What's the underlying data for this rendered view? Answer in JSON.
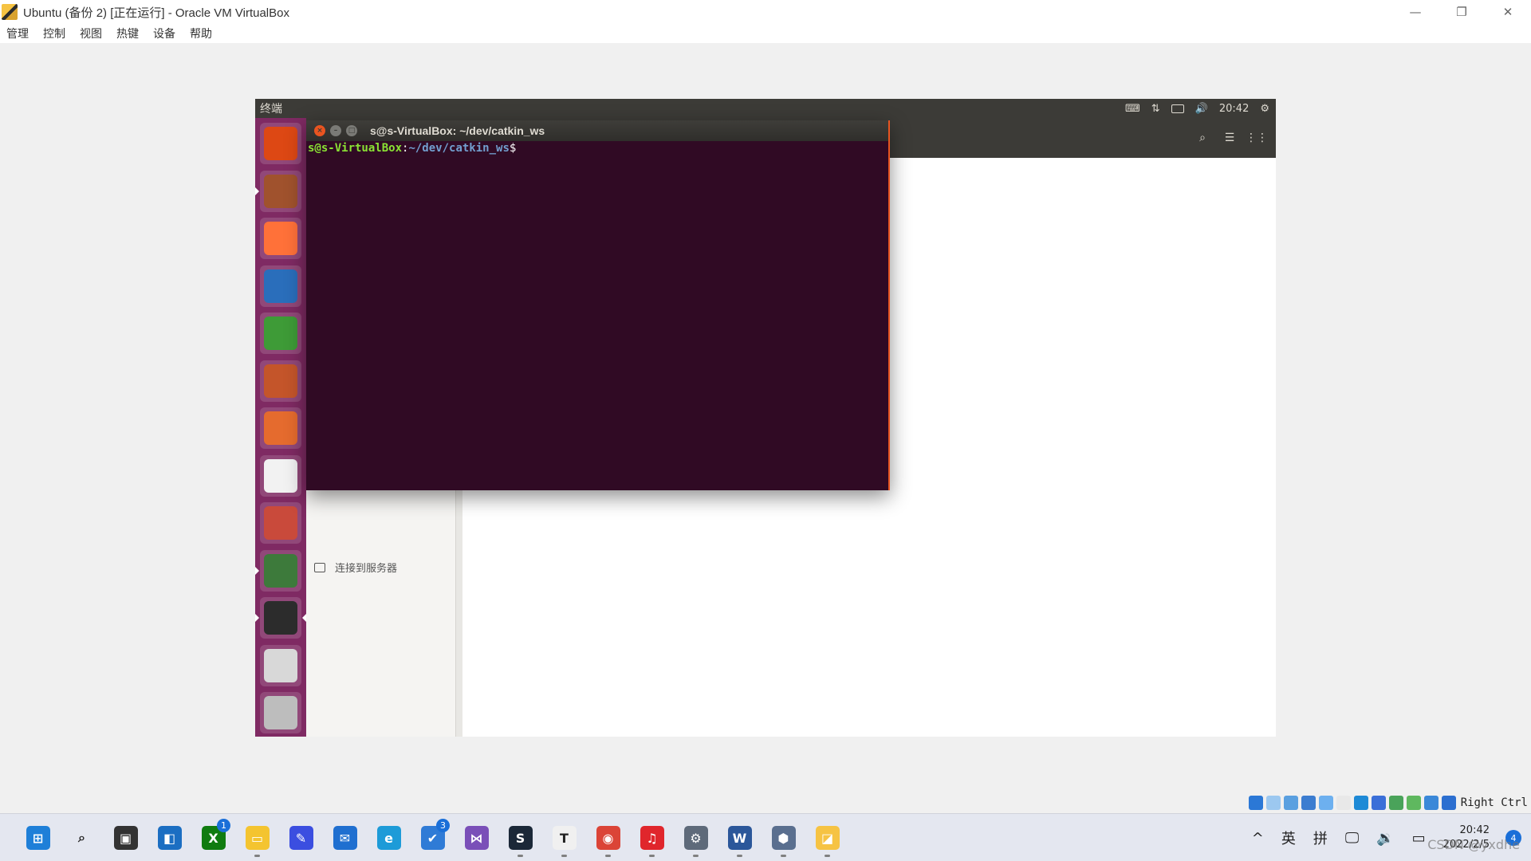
{
  "window": {
    "title": "Ubuntu (备份 2) [正在运行] - Oracle VM VirtualBox",
    "minimize_glyph": "—",
    "restore_glyph": "❐",
    "close_glyph": "✕"
  },
  "menubar": [
    "管理",
    "控制",
    "视图",
    "热键",
    "设备",
    "帮助"
  ],
  "statusbar": {
    "host_key": "Right Ctrl",
    "icons": [
      "hard-disk-icon",
      "optical-drive-icon",
      "audio-icon",
      "network-icon",
      "usb-icon",
      "shared-folder-icon",
      "display-icon",
      "video-capture-icon",
      "recording-icon",
      "cpu-icon",
      "mouse-integration-icon",
      "keyboard-capture-icon"
    ]
  },
  "ubuntu": {
    "topbar_title": "终端",
    "time": "20:42",
    "launcher": [
      {
        "name": "launcher-dash-icon",
        "color": "#dd4814"
      },
      {
        "name": "launcher-files-icon",
        "color": "#a0522d"
      },
      {
        "name": "launcher-firefox-icon",
        "color": "#ff7139"
      },
      {
        "name": "launcher-writer-icon",
        "color": "#2a6ebb"
      },
      {
        "name": "launcher-calc-icon",
        "color": "#3e9b37"
      },
      {
        "name": "launcher-impress-icon",
        "color": "#c4552a"
      },
      {
        "name": "launcher-software-icon",
        "color": "#e56b2e"
      },
      {
        "name": "launcher-amazon-icon",
        "color": "#f2f2f2"
      },
      {
        "name": "launcher-settings-icon",
        "color": "#c94a3b"
      },
      {
        "name": "launcher-updater-icon",
        "color": "#3d7a3b"
      },
      {
        "name": "launcher-terminal-icon",
        "color": "#2c2c2c"
      },
      {
        "name": "launcher-dvd-icon",
        "color": "#d8d8d8"
      },
      {
        "name": "launcher-trash-icon",
        "color": "#bdbdbd"
      }
    ],
    "nautilus": {
      "sidebar_item": "连接到服务器"
    },
    "terminal": {
      "title": "s@s-VirtualBox: ~/dev/catkin_ws",
      "prompt_user": "s@s-VirtualBox",
      "prompt_sep": ":",
      "prompt_path": "~/dev/catkin_ws",
      "prompt_end": "$"
    }
  },
  "taskbar": {
    "apps": [
      {
        "name": "start-icon",
        "color": "#1e7fd8",
        "glyph": "⊞",
        "dot": false,
        "badge": ""
      },
      {
        "name": "search-icon",
        "color": "transparent",
        "glyph": "⌕",
        "dot": false,
        "badge": ""
      },
      {
        "name": "task-view-icon",
        "color": "#333333",
        "glyph": "▣",
        "dot": false,
        "badge": ""
      },
      {
        "name": "widgets-icon",
        "color": "#1b6ec2",
        "glyph": "◧",
        "dot": false,
        "badge": ""
      },
      {
        "name": "xbox-icon",
        "color": "#107c10",
        "glyph": "X",
        "dot": false,
        "badge": "1"
      },
      {
        "name": "file-explorer-icon",
        "color": "#f4c430",
        "glyph": "▭",
        "dot": true,
        "badge": ""
      },
      {
        "name": "whiteboard-icon",
        "color": "#3b4ee0",
        "glyph": "✎",
        "dot": false,
        "badge": ""
      },
      {
        "name": "mail-icon",
        "color": "#1f6fd0",
        "glyph": "✉",
        "dot": false,
        "badge": ""
      },
      {
        "name": "edge-icon",
        "color": "#1d9bd8",
        "glyph": "e",
        "dot": false,
        "badge": ""
      },
      {
        "name": "todo-icon",
        "color": "#2f7bd6",
        "glyph": "✔",
        "dot": false,
        "badge": "3"
      },
      {
        "name": "visual-studio-icon",
        "color": "#7a4fb8",
        "glyph": "⋈",
        "dot": false,
        "badge": ""
      },
      {
        "name": "steam-icon",
        "color": "#1b2838",
        "glyph": "S",
        "dot": true,
        "badge": ""
      },
      {
        "name": "typora-icon",
        "color": "#f0f0f0",
        "glyph": "T",
        "dot": true,
        "badge": ""
      },
      {
        "name": "chrome-icon",
        "color": "#db4437",
        "glyph": "◉",
        "dot": true,
        "badge": ""
      },
      {
        "name": "netease-music-icon",
        "color": "#e0262c",
        "glyph": "♫",
        "dot": true,
        "badge": ""
      },
      {
        "name": "settings-icon",
        "color": "#5e6a7a",
        "glyph": "⚙",
        "dot": true,
        "badge": ""
      },
      {
        "name": "word-icon",
        "color": "#2b579a",
        "glyph": "W",
        "dot": true,
        "badge": ""
      },
      {
        "name": "virtualbox-manager-icon",
        "color": "#5a6f8f",
        "glyph": "⬢",
        "dot": true,
        "badge": ""
      },
      {
        "name": "virtualbox-vm-icon",
        "color": "#f6c343",
        "glyph": "◪",
        "dot": true,
        "badge": ""
      }
    ],
    "tray": {
      "chevron": "^",
      "lang": "英",
      "ime": "拼",
      "time": "20:42",
      "date": "2022/2/5",
      "notifications": "4"
    },
    "watermark": "CSDN @yxdhe"
  }
}
